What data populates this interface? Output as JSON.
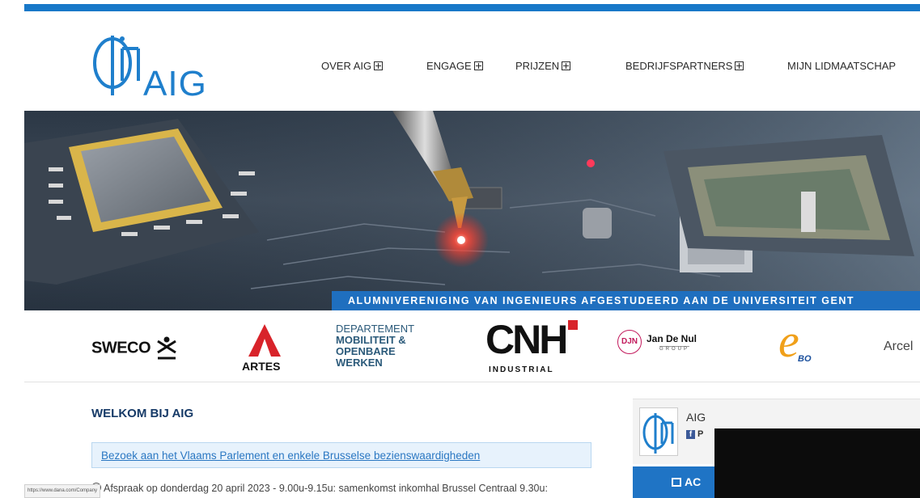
{
  "brand": {
    "logo_text": "AIG",
    "accent": "#1f7fcc",
    "navy": "#163a67"
  },
  "nav": {
    "items": [
      {
        "label": "OVER AIG",
        "has_submenu": true
      },
      {
        "label": "ENGAGE",
        "has_submenu": true
      },
      {
        "label": "PRIJZEN",
        "has_submenu": true
      },
      {
        "label": "BEDRIJFSPARTNERS",
        "has_submenu": true
      },
      {
        "label": "MIJN LIDMAATSCHAP",
        "has_submenu": false
      }
    ]
  },
  "hero": {
    "banner_text": "ALUMNIVERENIGING VAN INGENIEURS AFGESTUDEERD AAN DE UNIVERSITEIT GENT"
  },
  "partners": {
    "sweco": "SWECO",
    "artes": "ARTES",
    "departement": [
      "DEPARTEMENT",
      "MOBILITEIT &",
      "OPENBARE",
      "WERKEN"
    ],
    "cnh": "CNH",
    "cnh_sub": "INDUSTRIAL",
    "jan_de_nul_mark": "DJN",
    "jan_de_nul": "Jan De Nul",
    "jan_de_nul_sub": "GROUP",
    "ebo": "BO",
    "arcelor": "Arcel"
  },
  "main": {
    "welcome_title": "WELKOM BIJ AIG",
    "news_link": "Bezoek aan het Vlaams Parlement en enkele Brusselse bezienswaardigheden",
    "news_detail": "Afspraak op donderdag 20 april 2023 - 9.00u-9.15u: samenkomst inkomhal Brussel Centraal 9.30u:"
  },
  "sidebar": {
    "facebook_name": "AIG",
    "facebook_label": "P",
    "agenda_title": "AC"
  },
  "status_bar": {
    "url": "https://www.dana.com/Company"
  }
}
